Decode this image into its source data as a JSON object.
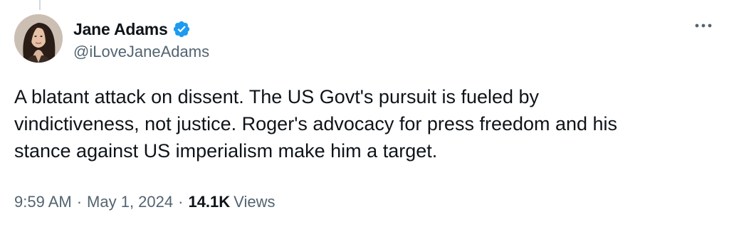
{
  "tweet": {
    "author": {
      "display_name": "Jane Adams",
      "handle": "@iLoveJaneAdams",
      "verified": true,
      "verified_color": "#1d9bf0"
    },
    "more_icon": "more-horizontal-icon",
    "text": "A blatant attack on dissent. The US Govt's pursuit is fueled by\nvindictiveness, not justice. Roger's advocacy for press freedom and his\nstance against US imperialism make him a target.",
    "meta": {
      "time": "9:59 AM",
      "separator": "·",
      "date": "May 1, 2024",
      "views_count": "14.1K",
      "views_label": "Views"
    }
  },
  "colors": {
    "text_primary": "#0f1419",
    "text_secondary": "#536471",
    "accent": "#1d9bf0",
    "thread_line": "#cfd9de"
  }
}
